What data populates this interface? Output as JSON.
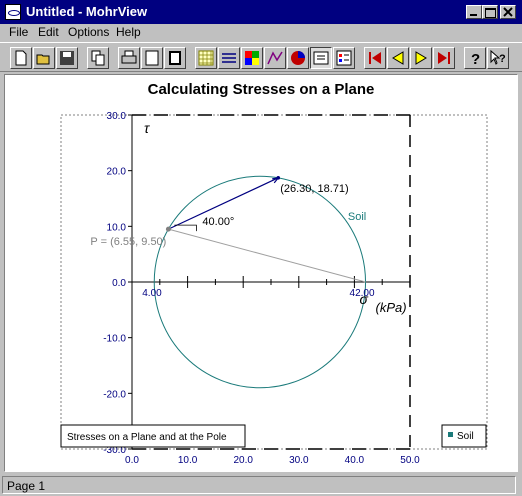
{
  "window": {
    "title": "Untitled - MohrView"
  },
  "menu": {
    "file": "File",
    "edit": "Edit",
    "options": "Options",
    "help": "Help"
  },
  "toolbar": {
    "buttons": [
      "new-icon",
      "open-icon",
      "save-icon",
      "copy-icon",
      "print-icon",
      "frame-icon",
      "fill-icon",
      "grid-icon",
      "lines-icon",
      "colors-icon",
      "wireframe-icon",
      "pie-icon",
      "text-icon",
      "legend-icon",
      "first-icon",
      "previous-icon",
      "next-icon",
      "last-icon",
      "help-icon",
      "context-help-icon"
    ],
    "pressed": [
      "text-icon"
    ]
  },
  "chart": {
    "title": "Calculating Stresses on a Plane",
    "xlabel": "(kPa)",
    "ylabel": "τ",
    "sigma_label": "σ",
    "point_label": "(26.30, 18.71)",
    "pole_label": "P = (6.55, 9.50)",
    "angle_label": "40.00°",
    "circle_label": "Soil",
    "axis_left_label": "4.00",
    "axis_right_label": "42.00",
    "legend_text": "Soil",
    "caption": "Stresses on a Plane and at the Pole",
    "colors": {
      "circle": "#1a7a7a",
      "tick_labels": "#000080",
      "axes": "#000000",
      "pole_line": "#a0a0a0",
      "point_line": "#000080"
    }
  },
  "chart_data": {
    "type": "scatter",
    "title": "Calculating Stresses on a Plane",
    "xlabel": "(kPa)",
    "ylabel": "τ",
    "xlim": [
      0,
      50
    ],
    "ylim": [
      -30,
      30
    ],
    "xticks": [
      "0.0",
      "10.0",
      "20.0",
      "30.0",
      "40.0",
      "50.0"
    ],
    "yticks": [
      "30.0",
      "20.0",
      "10.0",
      "0.0",
      "-10.0",
      "-20.0",
      "-30.0"
    ],
    "circle": {
      "name": "Soil",
      "sigma_min": 4.0,
      "sigma_max": 42.0,
      "center": 23.0,
      "radius": 19.0
    },
    "points": [
      {
        "label": "(26.30, 18.71)",
        "x": 26.3,
        "y": 18.71
      },
      {
        "label": "P = (6.55, 9.50)",
        "x": 6.55,
        "y": 9.5
      }
    ],
    "angle": "40.00°",
    "legend": [
      "Soil"
    ]
  },
  "status": {
    "page": "Page 1"
  }
}
